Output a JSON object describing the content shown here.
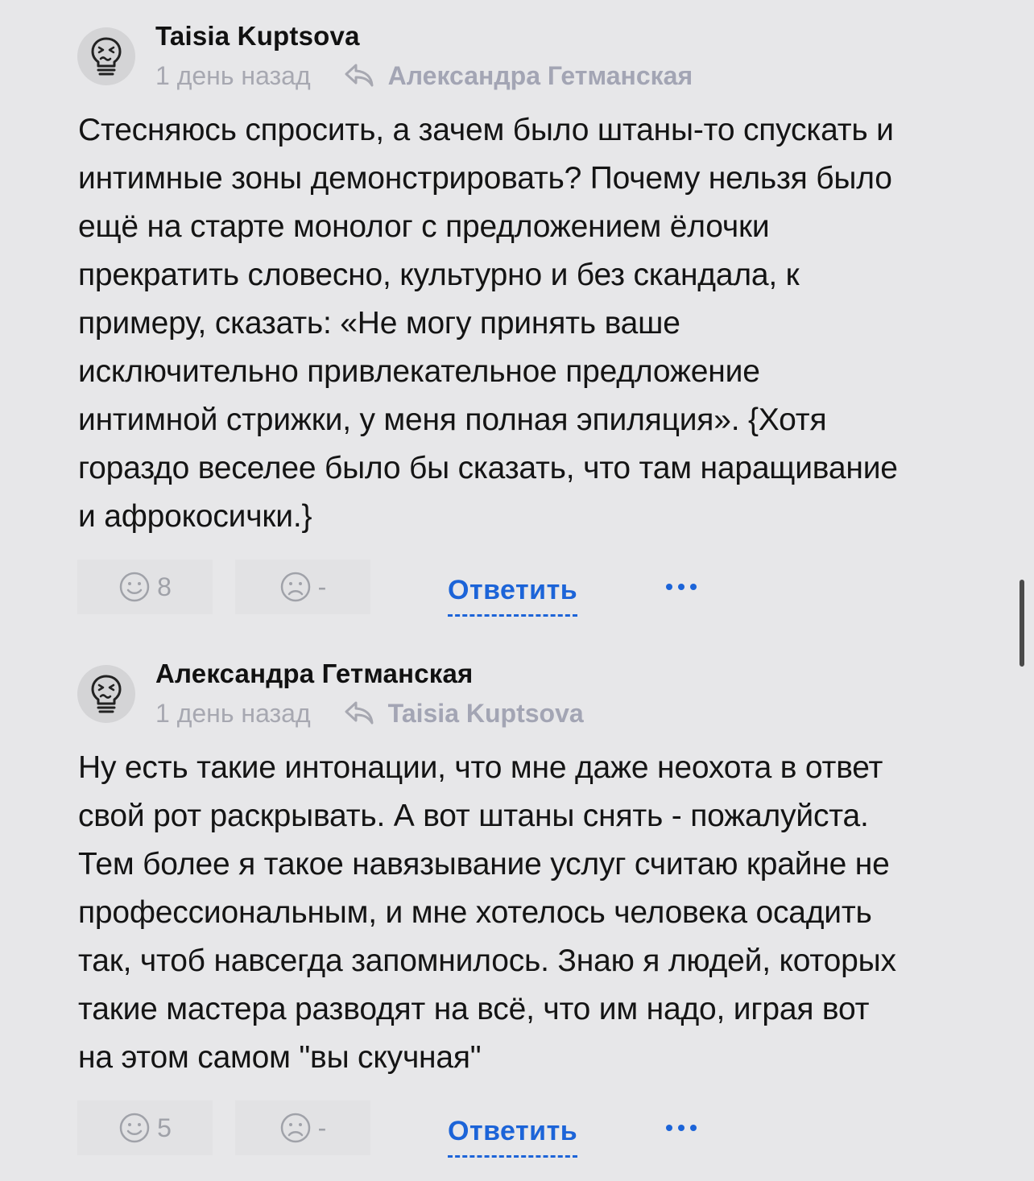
{
  "comments": [
    {
      "author": "Taisia Kuptsova",
      "time": "1 день назад",
      "reply_to": "Александра Гетманская",
      "text": "Стесняюсь спросить, а зачем было штаны-то спускать и\nинтимные зоны демонстрировать? Почему нельзя было\nещё на старте монолог с предложением ёлочки\nпрекратить словесно, культурно и без скандала, к\nпримеру, сказать: «Не могу принять ваше\nисключительно привлекательное предложение\nинтимной стрижки, у меня полная эпиляция». {Хотя\nгораздо веселее было бы сказать, что там наращивание\nи афрокосички.}",
      "likes": "8",
      "dislikes": "-",
      "reply_label": "Ответить"
    },
    {
      "author": "Александра Гетманская",
      "time": "1 день назад",
      "reply_to": "Taisia Kuptsova",
      "text": "Ну есть такие интонации, что мне даже неохота в ответ\nсвой рот раскрывать. А вот штаны снять - пожалуйста.\nТем более я такое навязывание услуг считаю крайне не\nпрофессиональным, и мне хотелось человека осадить\nтак, чтоб навсегда запомнилось. Знаю я людей, которых\nтакие мастера разводят на всё, что им надо, играя вот\nна этом самом \"вы скучная\"",
      "likes": "5",
      "dislikes": "-",
      "reply_label": "Ответить"
    }
  ],
  "icons": {
    "avatar": "dizzy-lightbulb-avatar-icon",
    "reply_to": "reply-arrow-icon",
    "like": "smile-icon",
    "dislike": "frown-icon",
    "more": "more-dots-icon"
  },
  "colors": {
    "background": "#e7e7e9",
    "accent": "#1c64d8",
    "muted": "#a7a8b1"
  }
}
